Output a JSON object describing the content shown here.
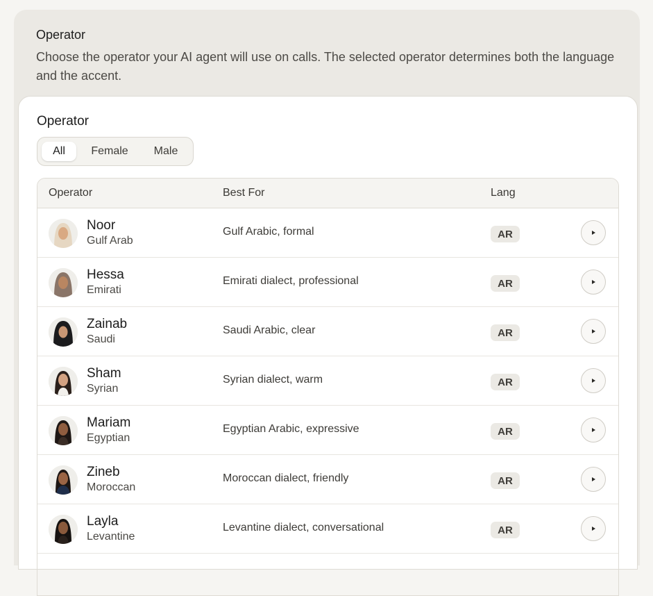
{
  "section": {
    "title": "Operator",
    "description": "Choose the operator your AI agent will use on calls. The selected operator determines both the language and the accent."
  },
  "card": {
    "title": "Operator",
    "filters": [
      "All",
      "Female",
      "Male"
    ],
    "active_filter": "All"
  },
  "table": {
    "headers": {
      "operator": "Operator",
      "best_for": "Best For",
      "lang": "Lang"
    },
    "rows": [
      {
        "name": "Noor",
        "region": "Gulf Arab",
        "best_for": "Gulf Arabic, formal",
        "lang": "AR",
        "avatar_icon": "hijab-woman-avatar"
      },
      {
        "name": "Hessa",
        "region": "Emirati",
        "best_for": "Emirati dialect, professional",
        "lang": "AR",
        "avatar_icon": "hijab-woman-avatar"
      },
      {
        "name": "Zainab",
        "region": "Saudi",
        "best_for": "Saudi Arabic, clear",
        "lang": "AR",
        "avatar_icon": "hijab-woman-avatar"
      },
      {
        "name": "Sham",
        "region": "Syrian",
        "best_for": "Syrian dialect, warm",
        "lang": "AR",
        "avatar_icon": "woman-avatar"
      },
      {
        "name": "Mariam",
        "region": "Egyptian",
        "best_for": "Egyptian Arabic, expressive",
        "lang": "AR",
        "avatar_icon": "woman-avatar"
      },
      {
        "name": "Zineb",
        "region": "Moroccan",
        "best_for": "Moroccan dialect, friendly",
        "lang": "AR",
        "avatar_icon": "woman-avatar"
      },
      {
        "name": "Layla",
        "region": "Levantine",
        "best_for": "Levantine dialect, conversational",
        "lang": "AR",
        "avatar_icon": "woman-avatar"
      }
    ]
  },
  "colors": {
    "page_bg": "#f6f5f2",
    "panel_bg": "#ebe9e4",
    "card_bg": "#ffffff",
    "badge_bg": "#ebe9e4"
  }
}
